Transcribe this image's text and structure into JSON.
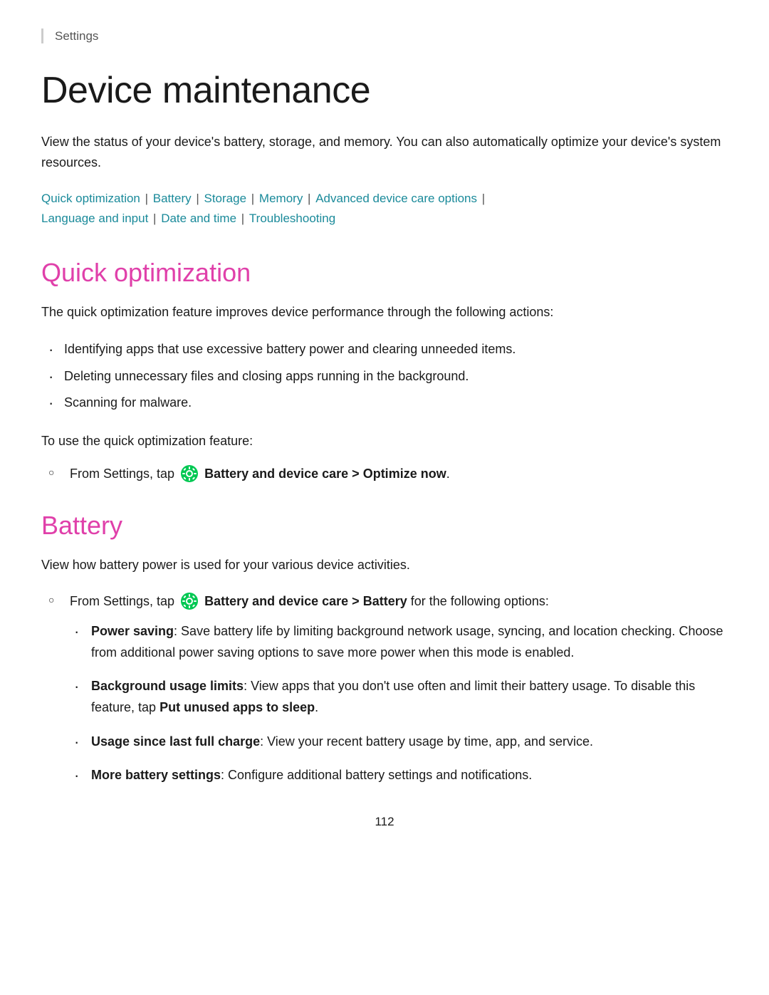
{
  "breadcrumb": {
    "label": "Settings"
  },
  "page": {
    "title": "Device maintenance",
    "description": "View the status of your device's battery, storage, and memory. You can also automatically optimize your device's system resources.",
    "page_number": "112"
  },
  "nav": {
    "links": [
      {
        "label": "Quick optimization",
        "href": "#quick-optimization"
      },
      {
        "label": "Battery",
        "href": "#battery"
      },
      {
        "label": "Storage",
        "href": "#storage"
      },
      {
        "label": "Memory",
        "href": "#memory"
      },
      {
        "label": "Advanced device care options",
        "href": "#advanced"
      },
      {
        "label": "Language and input",
        "href": "#language"
      },
      {
        "label": "Date and time",
        "href": "#date"
      },
      {
        "label": "Troubleshooting",
        "href": "#troubleshooting"
      }
    ]
  },
  "sections": {
    "quick_optimization": {
      "title": "Quick optimization",
      "description": "The quick optimization feature improves device performance through the following actions:",
      "bullets": [
        "Identifying apps that use excessive battery power and clearing unneeded items.",
        "Deleting unnecessary files and closing apps running in the background.",
        "Scanning for malware."
      ],
      "instruction_prefix": "To use the quick optimization feature:",
      "instruction_step": "From Settings, tap",
      "instruction_bold": "Battery and device care > Optimize now",
      "instruction_suffix": "."
    },
    "battery": {
      "title": "Battery",
      "description": "View how battery power is used for your various device activities.",
      "instruction_step": "From Settings, tap",
      "instruction_bold": "Battery and device care > Battery",
      "instruction_suffix": "for the following options:",
      "options": [
        {
          "label": "Power saving",
          "label_suffix": ": Save battery life by limiting background network usage, syncing, and location checking. Choose from additional power saving options to save more power when this mode is enabled."
        },
        {
          "label": "Background usage limits",
          "label_suffix": ": View apps that you don’t use often and limit their battery usage. To disable this feature, tap ",
          "bold_suffix": "Put unused apps to sleep",
          "end": "."
        },
        {
          "label": "Usage since last full charge",
          "label_suffix": ": View your recent battery usage by time, app, and service."
        },
        {
          "label": "More battery settings",
          "label_suffix": ": Configure additional battery settings and notifications."
        }
      ]
    }
  }
}
